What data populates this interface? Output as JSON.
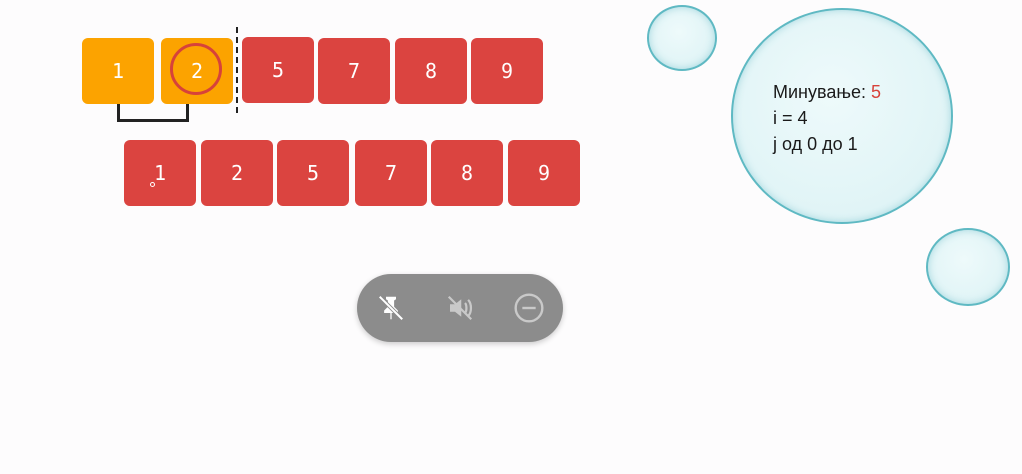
{
  "sorted_so_far": {
    "highlighted": [
      "1",
      "2"
    ],
    "rest": [
      "5",
      "7",
      "8",
      "9"
    ]
  },
  "result_row": [
    "1",
    "2",
    "5",
    "7",
    "8",
    "9"
  ],
  "info": {
    "pass_label": "Минување: ",
    "pass_value": "5",
    "i_line": "i = 4",
    "j_line": "j од 0 до 1"
  },
  "toolbar": {
    "icons": [
      "pin-off-icon",
      "volume-mute-icon",
      "minus-circle-icon"
    ]
  },
  "colors": {
    "box_red": "#db4440",
    "box_orange": "#fca300",
    "accent": "#d7423a",
    "bubble_border": "#5fb9c3",
    "toolbar_bg": "#8c8c8c"
  }
}
